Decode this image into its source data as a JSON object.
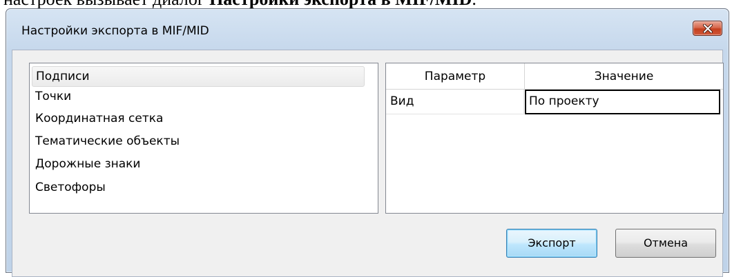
{
  "document": {
    "text_prefix": "настроек вызывает диалог ",
    "text_bold": "Настройки экспорта в MIF/MID",
    "text_suffix": "."
  },
  "window": {
    "title": "Настройки экспорта в MIF/MID",
    "close_icon": "close-x-icon"
  },
  "categories": {
    "items": [
      {
        "label": "Подписи",
        "selected": true
      },
      {
        "label": "Точки",
        "selected": false
      },
      {
        "label": "Координатная сетка",
        "selected": false
      },
      {
        "label": "Тематические объекты",
        "selected": false
      },
      {
        "label": "Дорожные знаки",
        "selected": false
      },
      {
        "label": "Светофоры",
        "selected": false
      }
    ]
  },
  "properties": {
    "columns": [
      "Параметр",
      "Значение"
    ],
    "rows": [
      {
        "parameter": "Вид",
        "value": "По проекту"
      }
    ]
  },
  "buttons": {
    "export_label": "Экспорт",
    "cancel_label": "Отмена"
  }
}
